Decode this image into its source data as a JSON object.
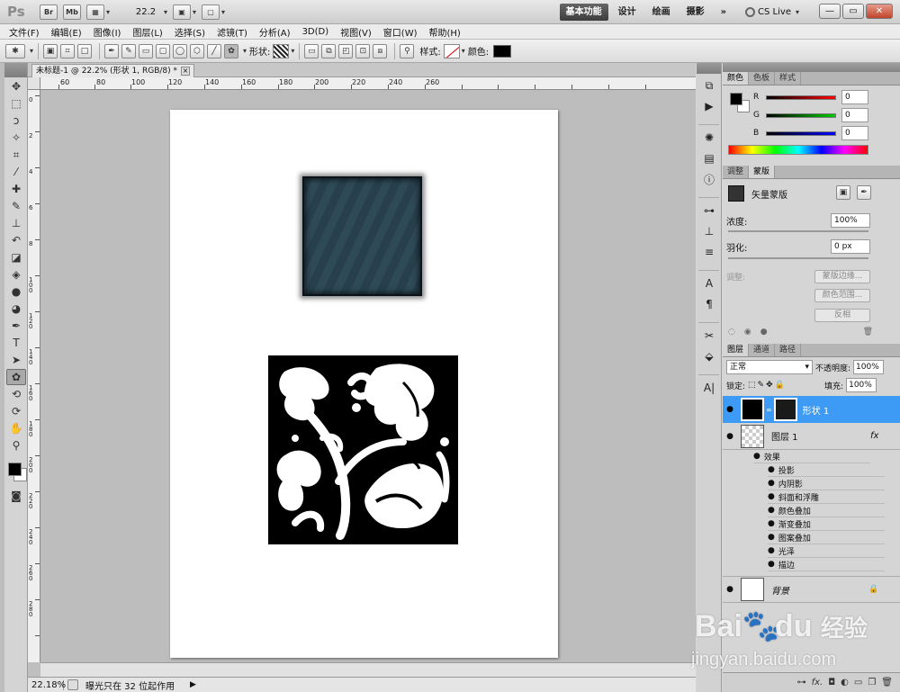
{
  "app": {
    "logo": "Ps",
    "titlebar_buttons": [
      "Br",
      "Mb"
    ],
    "zoom": "22.2",
    "workspaces": [
      "基本功能",
      "设计",
      "绘画",
      "摄影"
    ],
    "more": "»",
    "cslive": "CS Live",
    "window_controls": [
      "—",
      "▭",
      "✕"
    ]
  },
  "menu": [
    "文件(F)",
    "编辑(E)",
    "图像(I)",
    "图层(L)",
    "选择(S)",
    "滤镜(T)",
    "分析(A)",
    "3D(D)",
    "视图(V)",
    "窗口(W)",
    "帮助(H)"
  ],
  "options": {
    "shape_label": "形状:",
    "style_label": "样式:",
    "color_label": "颜色:",
    "color": "#000000"
  },
  "document": {
    "tab_title": "未标题-1 @ 22.2% (形状 1, RGB/8) *",
    "tab_close": "×",
    "h_ruler": [
      "60",
      "80",
      "100",
      "120",
      "140",
      "160",
      "180",
      "200",
      "220",
      "240",
      "260"
    ],
    "v_ruler": [
      "0",
      "2",
      "4",
      "6",
      "8",
      "1 0 0",
      "1 2 0",
      "1 4 0",
      "1 6 0",
      "1 8 0",
      "2 0 0",
      "2 2 0",
      "2 4 0",
      "2 6 0",
      "2 8 0"
    ],
    "shape_color": "#2b4552"
  },
  "status": {
    "zoom": "22.18%",
    "message": "曝光只在 32 位起作用",
    "arrow": "▶"
  },
  "color_panel": {
    "tabs": [
      "颜色",
      "色板",
      "样式"
    ],
    "r": "0",
    "g": "0",
    "b": "0",
    "r_label": "R",
    "g_label": "G",
    "b_label": "B"
  },
  "mask_panel": {
    "tabs": [
      "调整",
      "蒙版"
    ],
    "title": "矢量蒙版",
    "density_label": "浓度:",
    "density": "100%",
    "feather_label": "羽化:",
    "feather": "0 px",
    "refine_label": "调整:",
    "buttons": [
      "蒙版边缘...",
      "颜色范围...",
      "反相"
    ]
  },
  "layers_panel": {
    "tabs": [
      "图层",
      "通道",
      "路径"
    ],
    "blend_mode": "正常",
    "opacity_label": "不透明度:",
    "opacity": "100%",
    "lock_label": "锁定:",
    "fill_label": "填充:",
    "fill": "100%",
    "layers": [
      {
        "name": "形状 1",
        "selected": true
      },
      {
        "name": "图层 1",
        "fx": "fx"
      },
      {
        "name": "背景",
        "locked": true
      }
    ],
    "effects_label": "效果",
    "effects": [
      "投影",
      "内阴影",
      "斜面和浮雕",
      "颜色叠加",
      "渐变叠加",
      "图案叠加",
      "光泽",
      "描边"
    ]
  },
  "watermark": {
    "brand": "Bai",
    "brand2": "du",
    "cn": "经验",
    "url": "jingyan.baidu.com"
  }
}
